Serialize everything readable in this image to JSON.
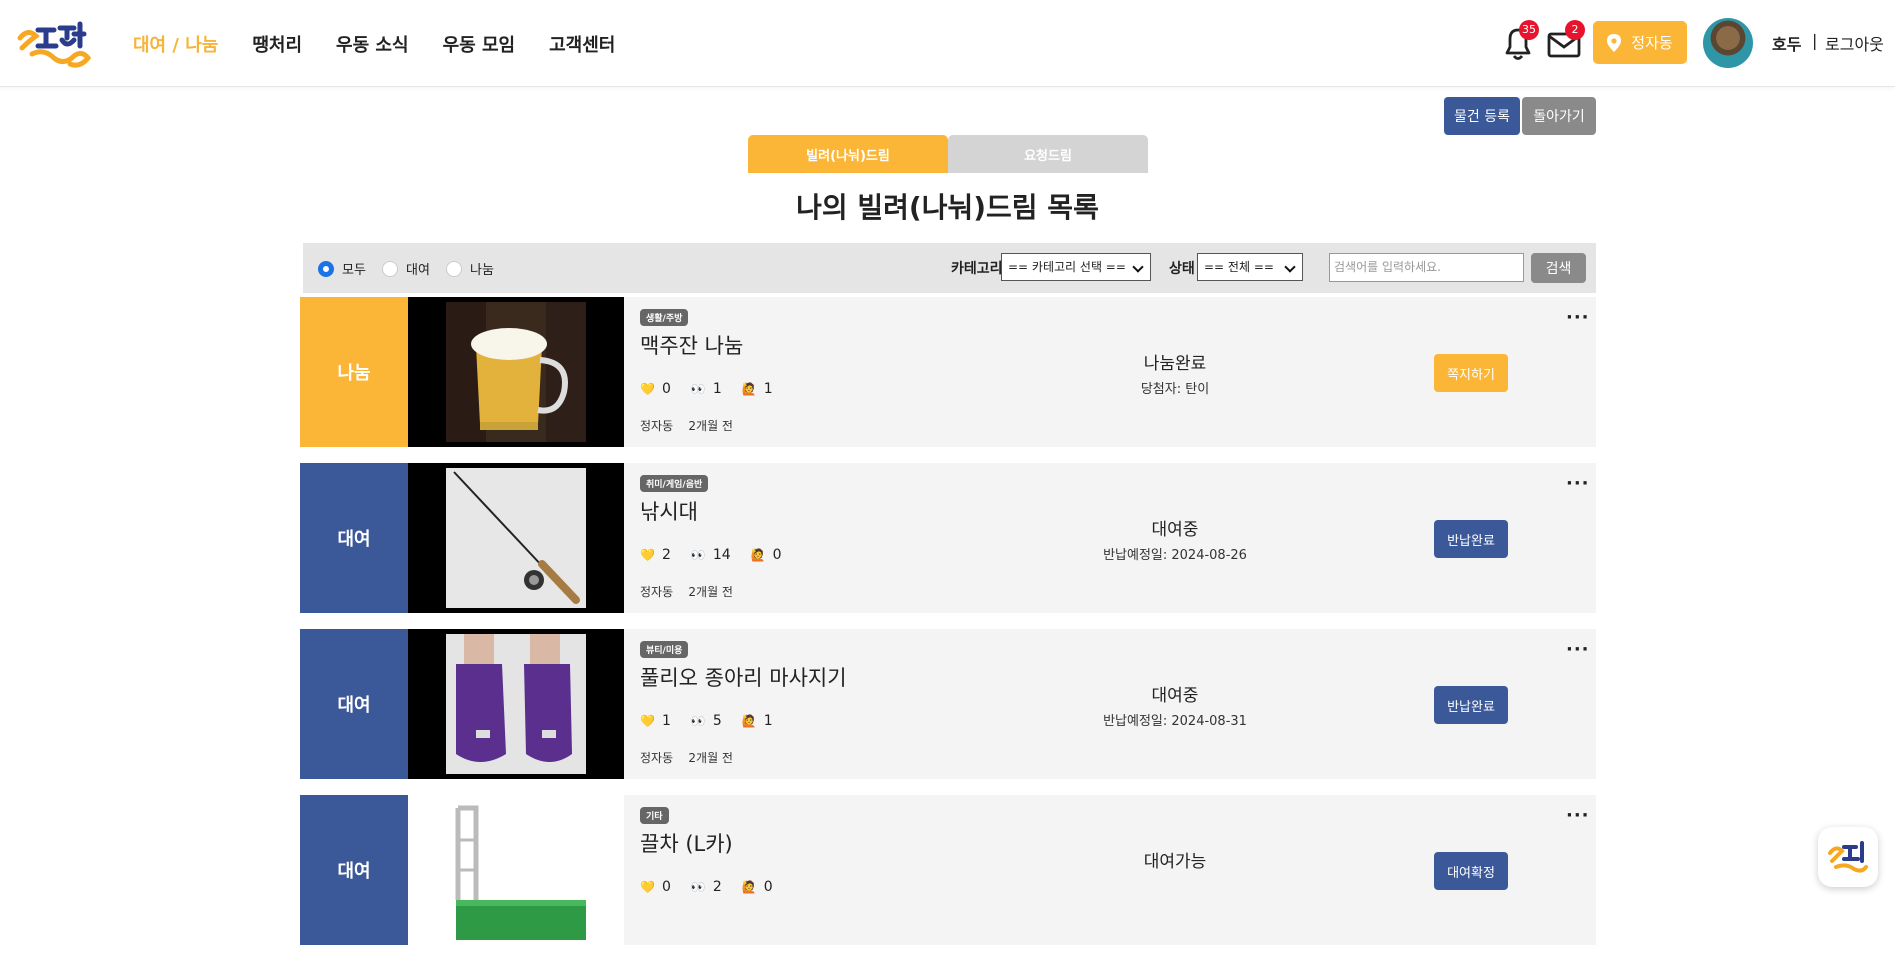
{
  "colors": {
    "accent": "#fbb637",
    "navy": "#3b5899",
    "gray": "#8a8a8a",
    "red_badge": "#e8132d"
  },
  "header": {
    "logo_text": "우동해",
    "nav": [
      "대여 / 나눔",
      "땡처리",
      "우동 소식",
      "우동 모임",
      "고객센터"
    ],
    "active_nav": "대여 / 나눔",
    "notifications_count": "35",
    "messages_count": "2",
    "location_label": "정자동",
    "user_name": "호두",
    "separator": "|",
    "logout_label": "로그아웃",
    "icons": {
      "bell": "bell-icon",
      "mail": "mail-icon",
      "location": "map-pin-icon"
    }
  },
  "toolbar": {
    "register_label": "물건 등록",
    "back_label": "돌아가기"
  },
  "tabs": [
    {
      "label": "빌려(나눠)드림",
      "active": true
    },
    {
      "label": "요청드림",
      "active": false
    }
  ],
  "page_title": "나의 빌려(나눠)드림 목록",
  "filter": {
    "radios": [
      {
        "label": "모두",
        "checked": true
      },
      {
        "label": "대여",
        "checked": false
      },
      {
        "label": "나눔",
        "checked": false
      }
    ],
    "category_label": "카테고리",
    "category_value": "== 카테고리 선택 ==",
    "status_label": "상태",
    "status_value": "== 전체 ==",
    "search_placeholder": "검색어를 입력하세요.",
    "search_label": "검색"
  },
  "items": [
    {
      "type": "나눔",
      "type_color": "#fbb637",
      "category": "생활/주방",
      "title": "맥주잔 나눔",
      "likes": "0",
      "views": "1",
      "requests": "1",
      "location": "정자동",
      "time": "2개월 전",
      "status": "나눔완료",
      "status_detail": "당첨자: 탄이",
      "action": "쪽지하기",
      "action_color": "#fbb637",
      "image": "beer-mug",
      "thumb_bg": "black"
    },
    {
      "type": "대여",
      "type_color": "#3b5899",
      "category": "취미/게임/음반",
      "title": "낚시대",
      "likes": "2",
      "views": "14",
      "requests": "0",
      "location": "정자동",
      "time": "2개월 전",
      "status": "대여중",
      "status_detail": "반납예정일: 2024-08-26",
      "action": "반납완료",
      "action_color": "#3b5899",
      "image": "fishing-rod",
      "thumb_bg": "black"
    },
    {
      "type": "대여",
      "type_color": "#3b5899",
      "category": "뷰티/미용",
      "title": "풀리오 종아리 마사지기",
      "likes": "1",
      "views": "5",
      "requests": "1",
      "location": "정자동",
      "time": "2개월 전",
      "status": "대여중",
      "status_detail": "반납예정일: 2024-08-31",
      "action": "반납완료",
      "action_color": "#3b5899",
      "image": "calf-massager",
      "thumb_bg": "black"
    },
    {
      "type": "대여",
      "type_color": "#3b5899",
      "category": "기타",
      "title": "끌차 (L카)",
      "likes": "0",
      "views": "2",
      "requests": "0",
      "location": "",
      "time": "",
      "status": "대여가능",
      "status_detail": "",
      "action": "대여확정",
      "action_color": "#3b5899",
      "image": "hand-cart",
      "thumb_bg": "white"
    }
  ],
  "stat_icons": {
    "like": "heart-icon",
    "view": "eyes-icon",
    "request": "raised-hand-icon"
  },
  "more_label": "···"
}
